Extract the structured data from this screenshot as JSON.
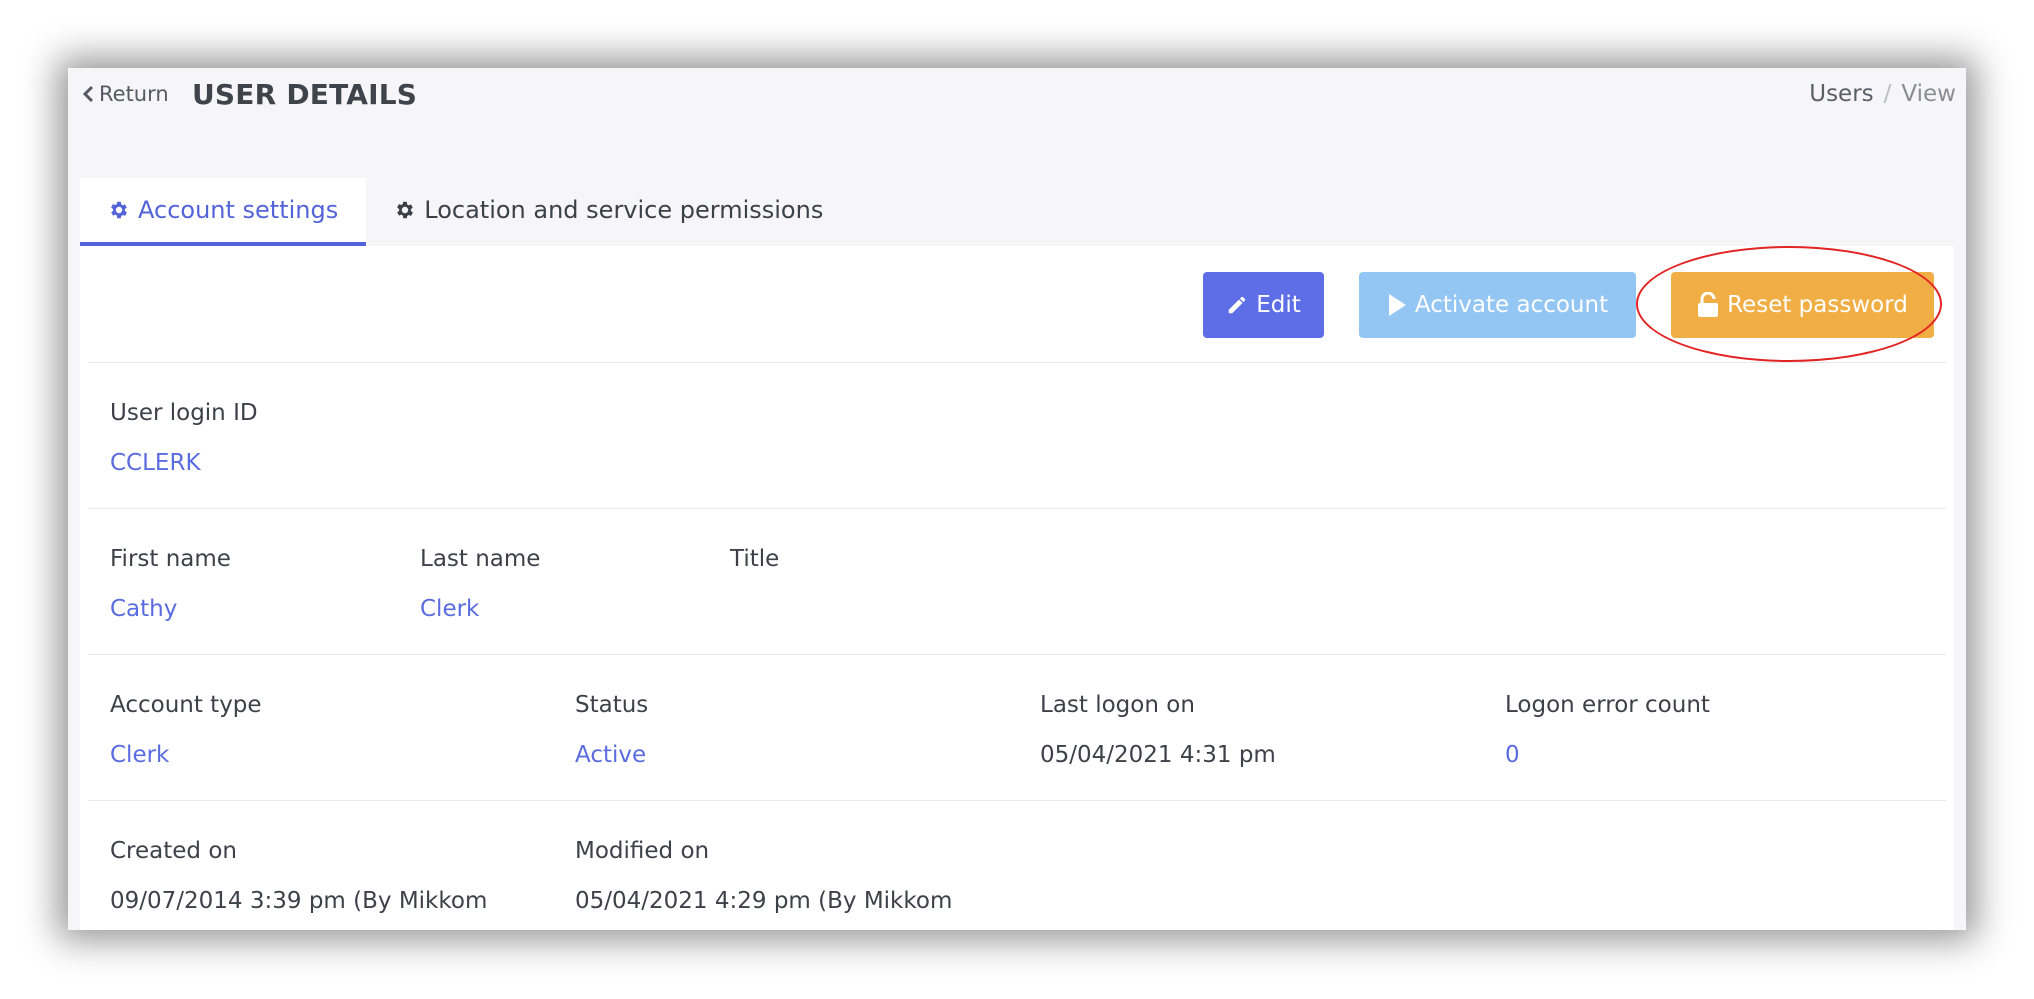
{
  "header": {
    "return_label": "Return",
    "title": "USER DETAILS",
    "breadcrumb": [
      "Users",
      "View"
    ],
    "breadcrumb_separator": "/"
  },
  "tabs": [
    {
      "label": "Account settings",
      "icon": "gear-icon",
      "active": true
    },
    {
      "label": "Location and service permissions",
      "icon": "gear-icon",
      "active": false
    }
  ],
  "actions": {
    "edit_label": "Edit",
    "activate_label": "Activate account",
    "reset_label": "Reset password"
  },
  "fields": {
    "user_login_id": {
      "label": "User login ID",
      "value": "CCLERK"
    },
    "first_name": {
      "label": "First name",
      "value": "Cathy"
    },
    "last_name": {
      "label": "Last name",
      "value": "Clerk"
    },
    "title": {
      "label": "Title",
      "value": ""
    },
    "account_type": {
      "label": "Account type",
      "value": "Clerk"
    },
    "status": {
      "label": "Status",
      "value": "Active"
    },
    "last_logon_on": {
      "label": "Last logon on",
      "value": "05/04/2021 4:31 pm"
    },
    "logon_error_count": {
      "label": "Logon error count",
      "value": "0"
    },
    "created_on": {
      "label": "Created on",
      "value": "09/07/2014 3:39 pm (By Mikkom"
    },
    "modified_on": {
      "label": "Modified on",
      "value": "05/04/2021 4:29 pm (By Mikkom"
    }
  },
  "colors": {
    "accent": "#5364d8",
    "edit_button": "#5d6ee6",
    "activate_button": "#93c6f3",
    "reset_button": "#f1ae44",
    "highlight": "#e32424"
  }
}
